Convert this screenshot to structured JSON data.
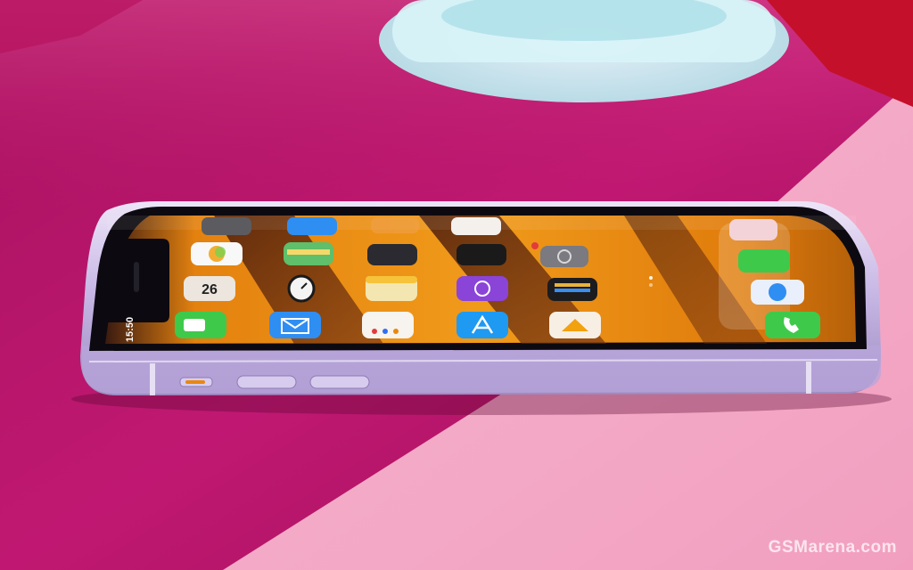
{
  "phone": {
    "status_time": "15:50",
    "app_labels": [
      "FaceTime",
      "Mail",
      "Reminders",
      "App Store",
      "Home"
    ],
    "calendar_day": "26"
  },
  "watermark": {
    "text": "GSMarena.com"
  },
  "colors": {
    "table_magenta": "#c01872",
    "paper_pink": "#f4a9c8",
    "phone_frame": "#c9b9e6",
    "wallpaper_orange": "#e8870f"
  }
}
